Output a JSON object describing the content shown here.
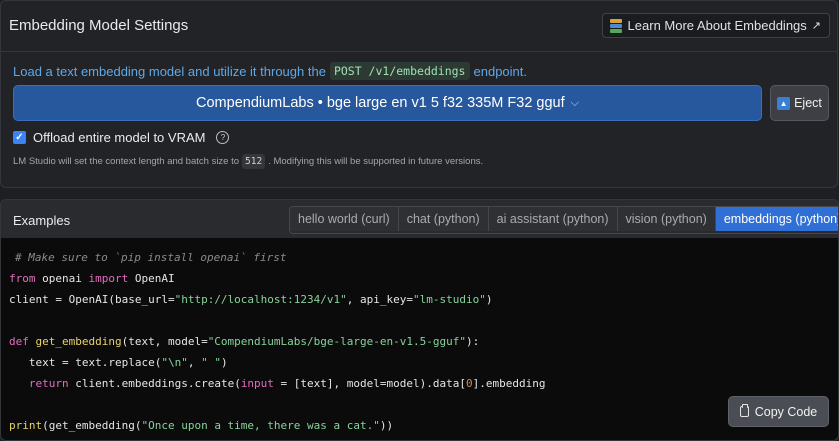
{
  "settings": {
    "title": "Embedding Model Settings",
    "learn_more": "Learn More About Embeddings",
    "description_before": "Load a text embedding model and utilize it through the",
    "endpoint": "POST /v1/embeddings",
    "description_after": "endpoint.",
    "model_name": "CompendiumLabs • bge large en v1 5 f32 335M F32 gguf",
    "eject_label": "Eject",
    "offload_label": "Offload entire model to VRAM",
    "offload_checked": true,
    "note_before": "LM Studio will set the context length and batch size to",
    "note_value": "512",
    "note_after": ". Modifying this will be supported in future versions."
  },
  "examples": {
    "title": "Examples",
    "tabs": [
      {
        "label": "hello world (curl)",
        "active": false
      },
      {
        "label": "chat (python)",
        "active": false
      },
      {
        "label": "ai assistant (python)",
        "active": false
      },
      {
        "label": "vision (python)",
        "active": false
      },
      {
        "label": "embeddings (python)",
        "active": true
      }
    ],
    "code": {
      "line1": "# Make sure to `pip install openai` first",
      "line2_kw1": "from",
      "line2_mid": " openai ",
      "line2_kw2": "import",
      "line2_end": " OpenAI",
      "line3_a": "client = OpenAI(base_url=",
      "line3_url": "\"http://localhost:1234/v1\"",
      "line3_b": ", api_key=",
      "line3_key": "\"lm-studio\"",
      "line3_c": ")",
      "line5_kw": "def",
      "line5_fn": "get_embedding",
      "line5_a": "(text, model=",
      "line5_model": "\"CompendiumLabs/bge-large-en-v1.5-gguf\"",
      "line5_b": "):",
      "line6_a": "   text = text.replace(",
      "line6_s1": "\"\\n\"",
      "line6_b": ", ",
      "line6_s2": "\" \"",
      "line6_c": ")",
      "line7_kw": "return",
      "line7_a": " client.embeddings.create(",
      "line7_kw2": "input",
      "line7_b": " = [text], model=model).data[",
      "line7_num": "0",
      "line7_c": "].embedding",
      "line9_fn": "print",
      "line9_a": "(get_embedding(",
      "line9_str": "\"Once upon a time, there was a cat.\"",
      "line9_b": "))"
    },
    "copy_label": "Copy Code"
  },
  "colors": {
    "accent": "#2f6fd6",
    "model_button": "#27579c",
    "keyword": "#e56cc0",
    "string": "#86d39a"
  }
}
